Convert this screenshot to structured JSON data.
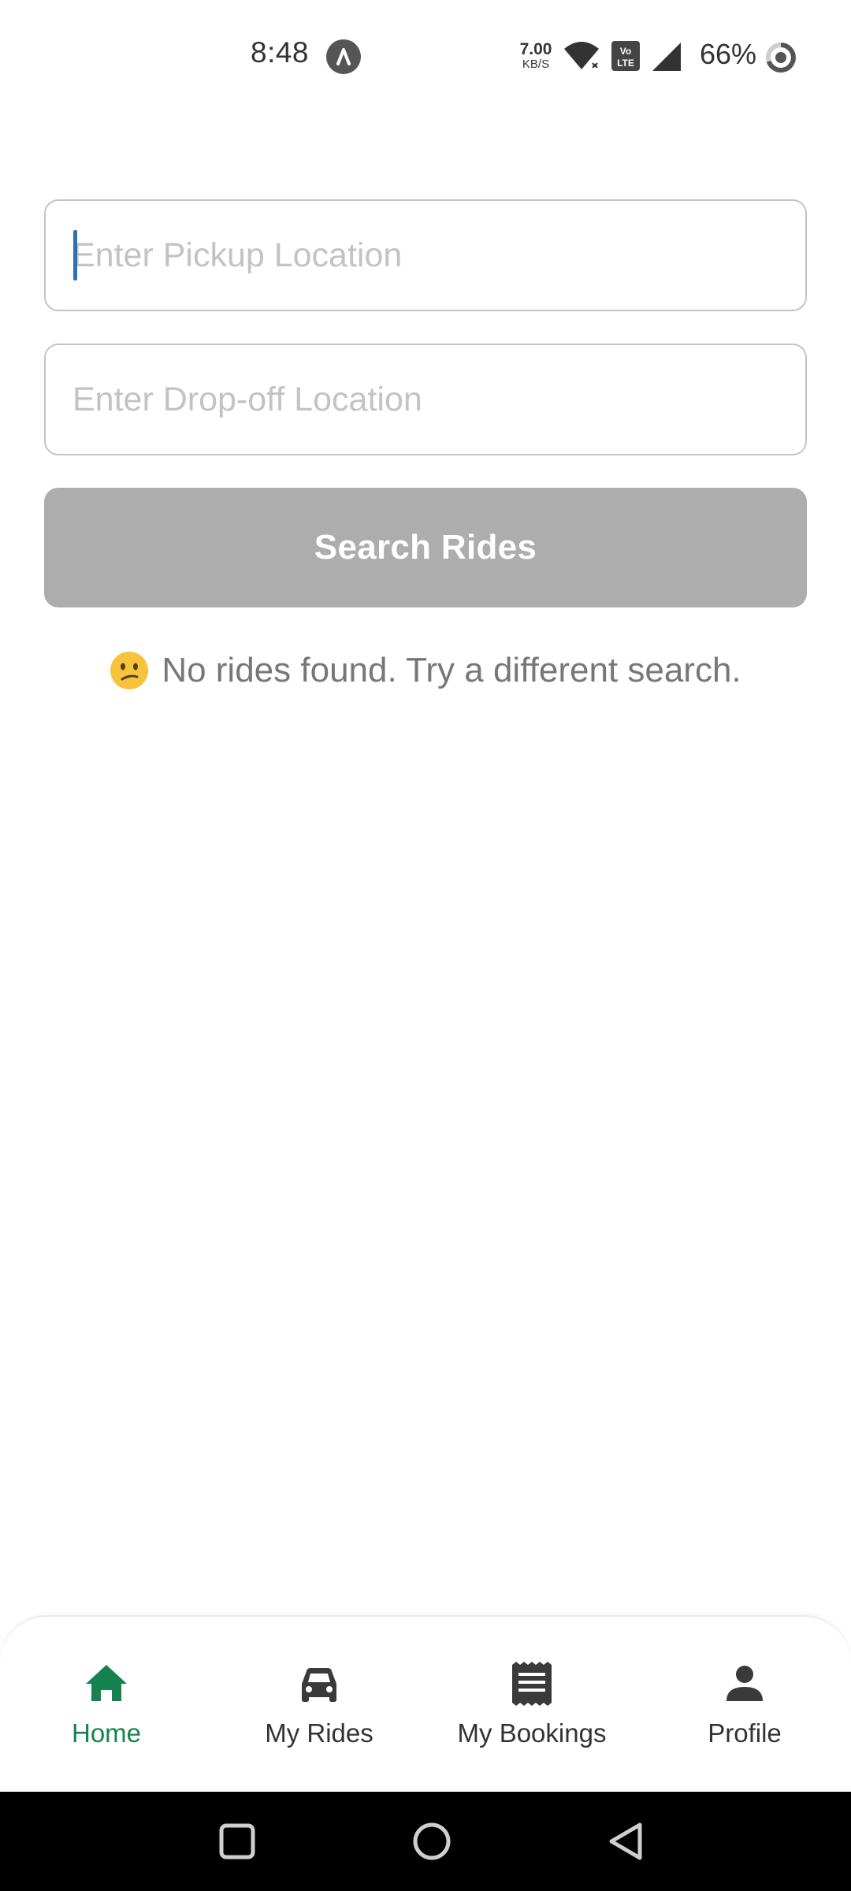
{
  "status_bar": {
    "time": "8:48",
    "network_speed_value": "7.00",
    "network_speed_unit": "KB/S",
    "battery_percent": "66%",
    "icons": [
      "app-notification-icon",
      "wifi-icon",
      "volte-icon",
      "cell-signal-icon",
      "battery-ring-icon"
    ]
  },
  "search": {
    "pickup_placeholder": "Enter Pickup Location",
    "pickup_value": "",
    "dropoff_placeholder": "Enter Drop-off Location",
    "dropoff_value": "",
    "button_label": "Search Rides"
  },
  "results": {
    "empty_message": "No rides found. Try a different search.",
    "empty_icon": "confused-face-emoji"
  },
  "tabs": [
    {
      "label": "Home",
      "icon": "home-icon",
      "active": true
    },
    {
      "label": "My Rides",
      "icon": "car-icon",
      "active": false
    },
    {
      "label": "My Bookings",
      "icon": "receipt-icon",
      "active": false
    },
    {
      "label": "Profile",
      "icon": "person-icon",
      "active": false
    }
  ],
  "nav_bar": {
    "buttons": [
      "recents-square-icon",
      "home-circle-icon",
      "back-triangle-icon"
    ]
  },
  "colors": {
    "accent": "#15834f",
    "button_disabled": "#adadad",
    "input_border": "#c4c4c4",
    "placeholder": "#c3c3c3",
    "message_text": "#777777"
  }
}
